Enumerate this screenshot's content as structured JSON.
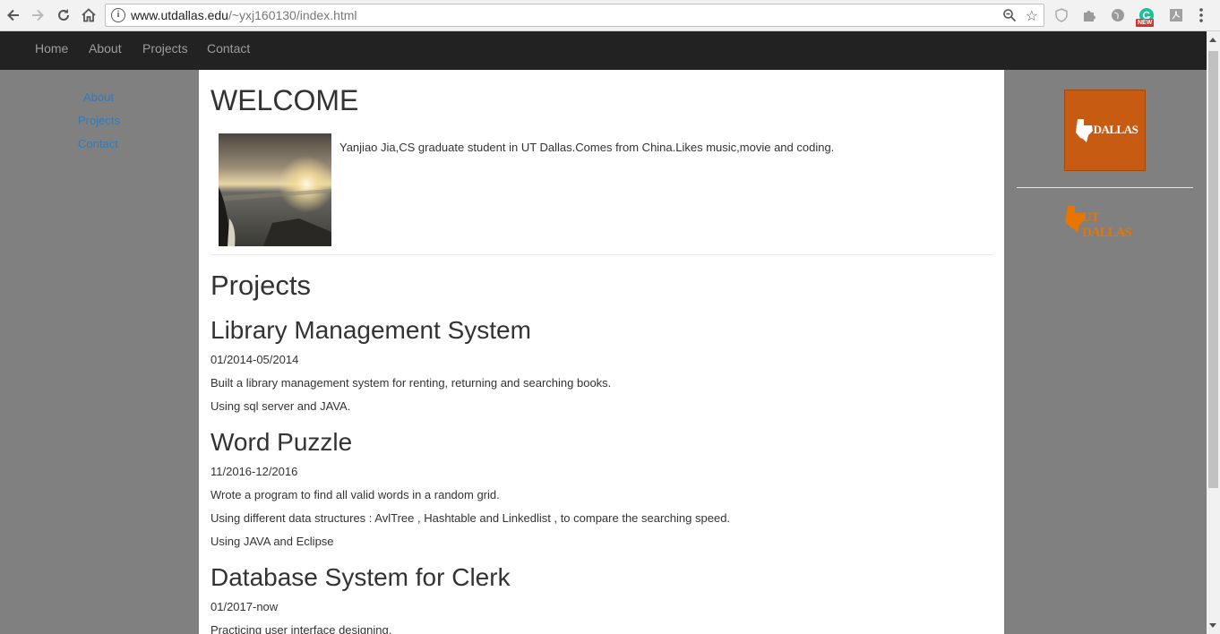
{
  "browser": {
    "url_host": "www.utdallas.edu",
    "url_path": "/~yxj160130/index.html",
    "ext_badge": "NEW"
  },
  "nav": {
    "items": [
      "Home",
      "About",
      "Projects",
      "Contact"
    ]
  },
  "sidebar": {
    "items": [
      "About",
      "Projects",
      "Contact"
    ]
  },
  "welcome": {
    "title": "WELCOME",
    "intro": "Yanjiao Jia,CS graduate student in UT Dallas.Comes from China.Likes music,movie and coding."
  },
  "projects": {
    "heading": "Projects",
    "items": [
      {
        "title": "Library Management System",
        "date": "01/2014-05/2014",
        "lines": [
          "Built a library management system for renting, returning and searching books.",
          "Using sql server and JAVA."
        ]
      },
      {
        "title": "Word Puzzle",
        "date": "11/2016-12/2016",
        "lines": [
          "Wrote a program to find all valid words in a random grid.",
          "Using different data structures : AvlTree , Hashtable and Linkedlist , to compare the searching speed.",
          "Using JAVA and Eclipse"
        ]
      },
      {
        "title": "Database System for Clerk",
        "date": "01/2017-now",
        "lines": [
          "Practicing user interface designing."
        ]
      }
    ]
  },
  "logos": {
    "logo1_text": "UT DALLAS",
    "logo2_text": "UT DALLAS"
  },
  "colors": {
    "navbar": "#222222",
    "link": "#337ab7",
    "utd_orange": "#c75b12"
  }
}
